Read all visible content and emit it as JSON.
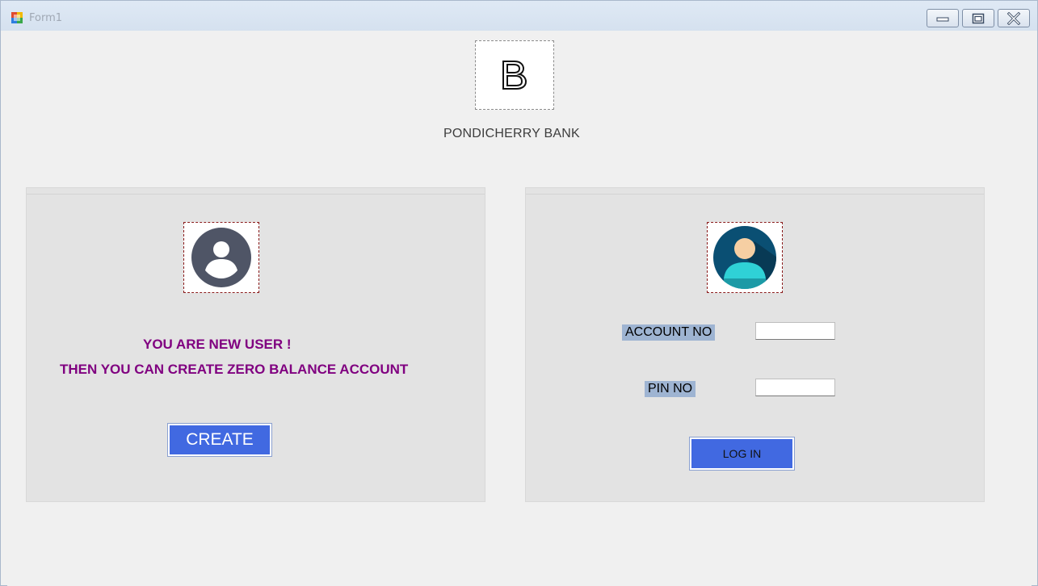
{
  "window": {
    "title": "Form1",
    "controls": {
      "minimize": "minimize-icon",
      "maximize": "maximize-icon",
      "close": "close-icon"
    }
  },
  "header": {
    "bank_name": "PONDICHERRY BANK"
  },
  "new_user_panel": {
    "line1": "YOU ARE NEW USER  !",
    "line2": "THEN YOU CAN CREATE ZERO BALANCE ACCOUNT",
    "create_label": "CREATE"
  },
  "login_panel": {
    "account_label": "ACCOUNT NO",
    "account_value": "",
    "pin_label": "PIN NO",
    "pin_value": "",
    "login_label": "LOG IN"
  },
  "colors": {
    "accent_blue": "#4169e1",
    "message_purple": "#800080",
    "label_highlight": "#9eb4d2"
  }
}
